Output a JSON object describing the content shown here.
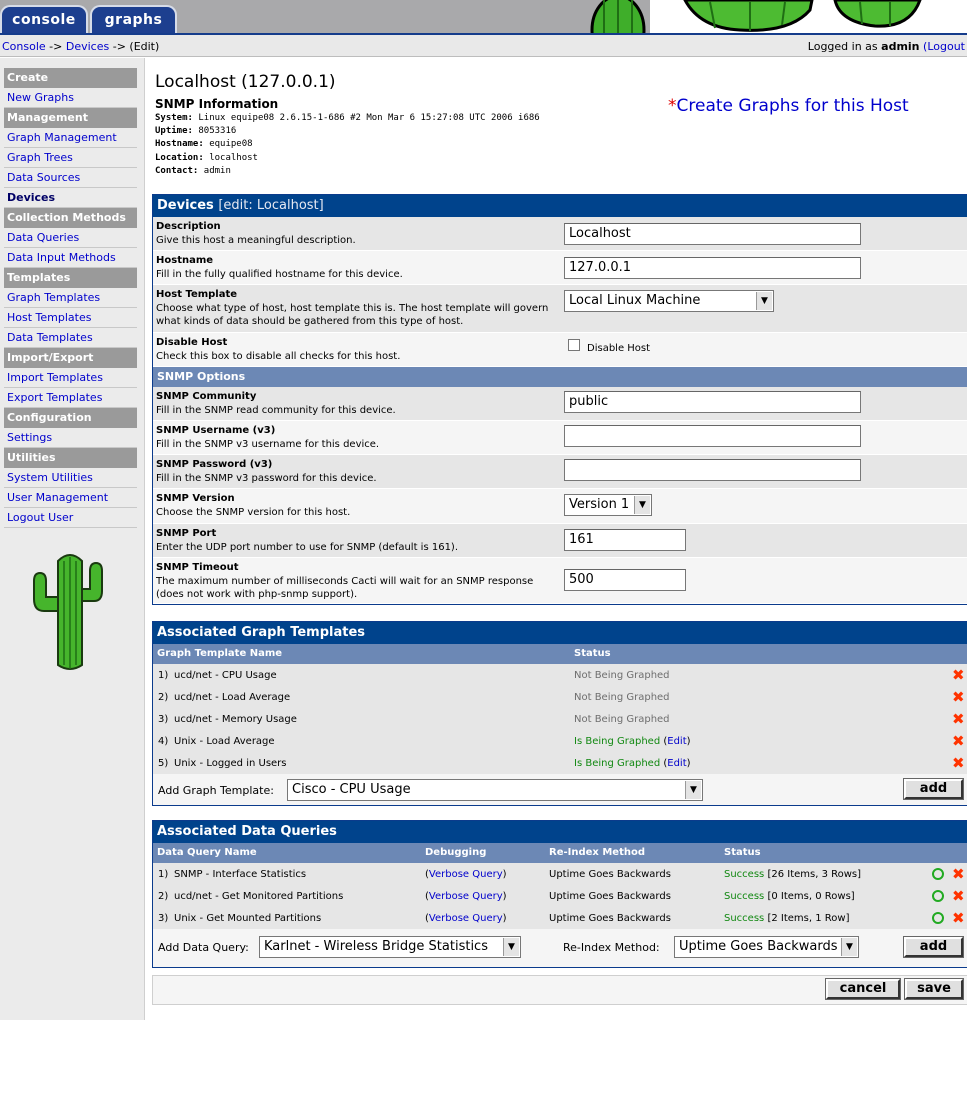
{
  "tabs": {
    "console": "console",
    "graphs": "graphs"
  },
  "breadcrumb": {
    "console": "Console",
    "sep1": "->",
    "devices": "Devices",
    "sep2": "->",
    "current": "(Edit)"
  },
  "login": {
    "prefix": "Logged in as",
    "user": "admin",
    "logout": "(Logout"
  },
  "sidebar": {
    "items": [
      {
        "type": "head",
        "label": "Create"
      },
      {
        "type": "item",
        "label": "New Graphs"
      },
      {
        "type": "head",
        "label": "Management"
      },
      {
        "type": "item",
        "label": "Graph Management"
      },
      {
        "type": "item",
        "label": "Graph Trees"
      },
      {
        "type": "item",
        "label": "Data Sources"
      },
      {
        "type": "item",
        "label": "Devices",
        "active": true
      },
      {
        "type": "head",
        "label": "Collection Methods"
      },
      {
        "type": "item",
        "label": "Data Queries"
      },
      {
        "type": "item",
        "label": "Data Input Methods"
      },
      {
        "type": "head",
        "label": "Templates"
      },
      {
        "type": "item",
        "label": "Graph Templates"
      },
      {
        "type": "item",
        "label": "Host Templates"
      },
      {
        "type": "item",
        "label": "Data Templates"
      },
      {
        "type": "head",
        "label": "Import/Export"
      },
      {
        "type": "item",
        "label": "Import Templates"
      },
      {
        "type": "item",
        "label": "Export Templates"
      },
      {
        "type": "head",
        "label": "Configuration"
      },
      {
        "type": "item",
        "label": "Settings"
      },
      {
        "type": "head",
        "label": "Utilities"
      },
      {
        "type": "item",
        "label": "System Utilities"
      },
      {
        "type": "item",
        "label": "User Management"
      },
      {
        "type": "item",
        "label": "Logout User"
      }
    ]
  },
  "host": {
    "title": "Localhost (127.0.0.1)",
    "snmp_heading": "SNMP Information",
    "snmp_info": [
      {
        "key": "System:",
        "value": "Linux equipe08 2.6.15-1-686 #2 Mon Mar 6 15:27:08 UTC 2006 i686"
      },
      {
        "key": "Uptime:",
        "value": "8053316"
      },
      {
        "key": "Hostname:",
        "value": "equipe08"
      },
      {
        "key": "Location:",
        "value": "localhost"
      },
      {
        "key": "Contact:",
        "value": "admin"
      }
    ],
    "create_star": "*",
    "create_link": "Create Graphs for this Host"
  },
  "devices": {
    "title": "Devices",
    "subtitle": "[edit: Localhost]",
    "description_label": "Description",
    "description_help": "Give this host a meaningful description.",
    "description_value": "Localhost",
    "hostname_label": "Hostname",
    "hostname_help": "Fill in the fully qualified hostname for this device.",
    "hostname_value": "127.0.0.1",
    "template_label": "Host Template",
    "template_help": "Choose what type of host, host template this is. The host template will govern what kinds of data should be gathered from this type of host.",
    "template_value": "Local Linux Machine",
    "disable_label": "Disable Host",
    "disable_help": "Check this box to disable all checks for this host.",
    "disable_checkbox_label": "Disable Host",
    "snmp_options": "SNMP Options",
    "community_label": "SNMP Community",
    "community_help": "Fill in the SNMP read community for this device.",
    "community_value": "public",
    "username_label": "SNMP Username (v3)",
    "username_help": "Fill in the SNMP v3 username for this device.",
    "username_value": "",
    "password_label": "SNMP Password (v3)",
    "password_help": "Fill in the SNMP v3 password for this device.",
    "password_value": "",
    "version_label": "SNMP Version",
    "version_help": "Choose the SNMP version for this host.",
    "version_value": "Version 1",
    "port_label": "SNMP Port",
    "port_help": "Enter the UDP port number to use for SNMP (default is 161).",
    "port_value": "161",
    "timeout_label": "SNMP Timeout",
    "timeout_help": "The maximum number of milliseconds Cacti will wait for an SNMP response (does not work with php-snmp support).",
    "timeout_value": "500"
  },
  "graph_templates": {
    "title": "Associated Graph Templates",
    "col_name": "Graph Template Name",
    "col_status": "Status",
    "rows": [
      {
        "num": "1)",
        "name": "ucd/net - CPU Usage",
        "status": "Not Being Graphed",
        "edit": ""
      },
      {
        "num": "2)",
        "name": "ucd/net - Load Average",
        "status": "Not Being Graphed",
        "edit": ""
      },
      {
        "num": "3)",
        "name": "ucd/net - Memory Usage",
        "status": "Not Being Graphed",
        "edit": ""
      },
      {
        "num": "4)",
        "name": "Unix - Load Average",
        "status": "Is Being Graphed",
        "edit": "Edit"
      },
      {
        "num": "5)",
        "name": "Unix - Logged in Users",
        "status": "Is Being Graphed",
        "edit": "Edit"
      }
    ],
    "add_label": "Add Graph Template:",
    "add_value": "Cisco - CPU Usage",
    "add_button": "add"
  },
  "data_queries": {
    "title": "Associated Data Queries",
    "col_name": "Data Query Name",
    "col_debug": "Debugging",
    "col_reindex": "Re-Index Method",
    "col_status": "Status",
    "rows": [
      {
        "num": "1)",
        "name": "SNMP - Interface Statistics",
        "debug": "Verbose Query",
        "reindex": "Uptime Goes Backwards",
        "status": "Success",
        "detail": "[26 Items, 3 Rows]"
      },
      {
        "num": "2)",
        "name": "ucd/net - Get Monitored Partitions",
        "debug": "Verbose Query",
        "reindex": "Uptime Goes Backwards",
        "status": "Success",
        "detail": "[0 Items, 0 Rows]"
      },
      {
        "num": "3)",
        "name": "Unix - Get Mounted Partitions",
        "debug": "Verbose Query",
        "reindex": "Uptime Goes Backwards",
        "status": "Success",
        "detail": "[2 Items, 1 Row]"
      }
    ],
    "add_label": "Add Data Query:",
    "add_value": "Karlnet - Wireless Bridge Statistics",
    "reindex_label": "Re-Index Method:",
    "reindex_value": "Uptime Goes Backwards",
    "add_button": "add"
  },
  "actions": {
    "cancel": "cancel",
    "save": "save"
  }
}
